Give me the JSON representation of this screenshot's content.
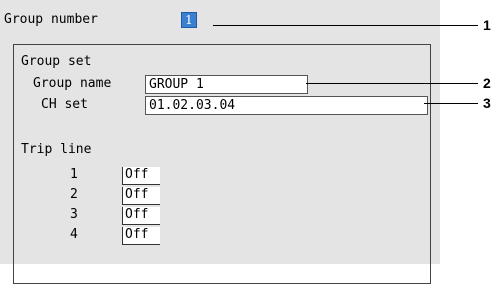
{
  "header": {
    "group_number_label": "Group number",
    "group_number_value": "1"
  },
  "group_set": {
    "title": "Group set",
    "group_name_label": "Group name",
    "group_name_value": "GROUP 1",
    "ch_set_label": "CH set",
    "ch_set_value": "01.02.03.04"
  },
  "trip_line": {
    "title": "Trip line",
    "rows": [
      {
        "number": "1",
        "value": "Off"
      },
      {
        "number": "2",
        "value": "Off"
      },
      {
        "number": "3",
        "value": "Off"
      },
      {
        "number": "4",
        "value": "Off"
      }
    ]
  },
  "callouts": [
    "1",
    "2",
    "3"
  ],
  "colors": {
    "screen_bg": "#e4e4e4",
    "selection": "#3b7fd0"
  }
}
